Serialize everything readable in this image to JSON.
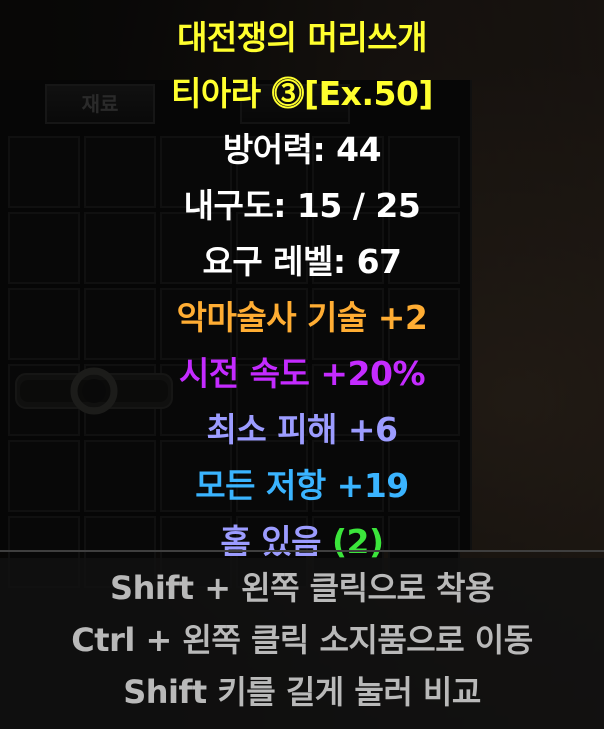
{
  "inventory": {
    "materials_tab": "재료"
  },
  "item": {
    "name": "대전쟁의 머리쓰개",
    "type": "티아라 ⓷[Ex.50]",
    "defense": "방어력: 44",
    "durability": "내구도: 15 / 25",
    "required_level": "요구 레벨: 67",
    "stats": {
      "skill": "악마술사 기술 +2",
      "cast_speed": "시전 속도 +20%",
      "min_damage": "최소 피해 +6",
      "resist_all": "모든 저항 +19",
      "sockets_label": "홈 있음 ",
      "sockets_count": "(2)"
    }
  },
  "hints": {
    "equip": "Shift + 왼쪽 클릭으로 착용",
    "move": "Ctrl + 왼쪽 클릭 소지품으로 이동",
    "compare": "Shift 키를 길게 눌러 비교"
  },
  "colors": {
    "unique_name": "#ffff2e",
    "base": "#ffffff",
    "class_skill": "#ffad33",
    "fcr": "#c42bff",
    "magic": "#9c9cff",
    "resist": "#3ab4ff",
    "sockets_count": "#3be53b",
    "hint": "#b9b9b9"
  }
}
